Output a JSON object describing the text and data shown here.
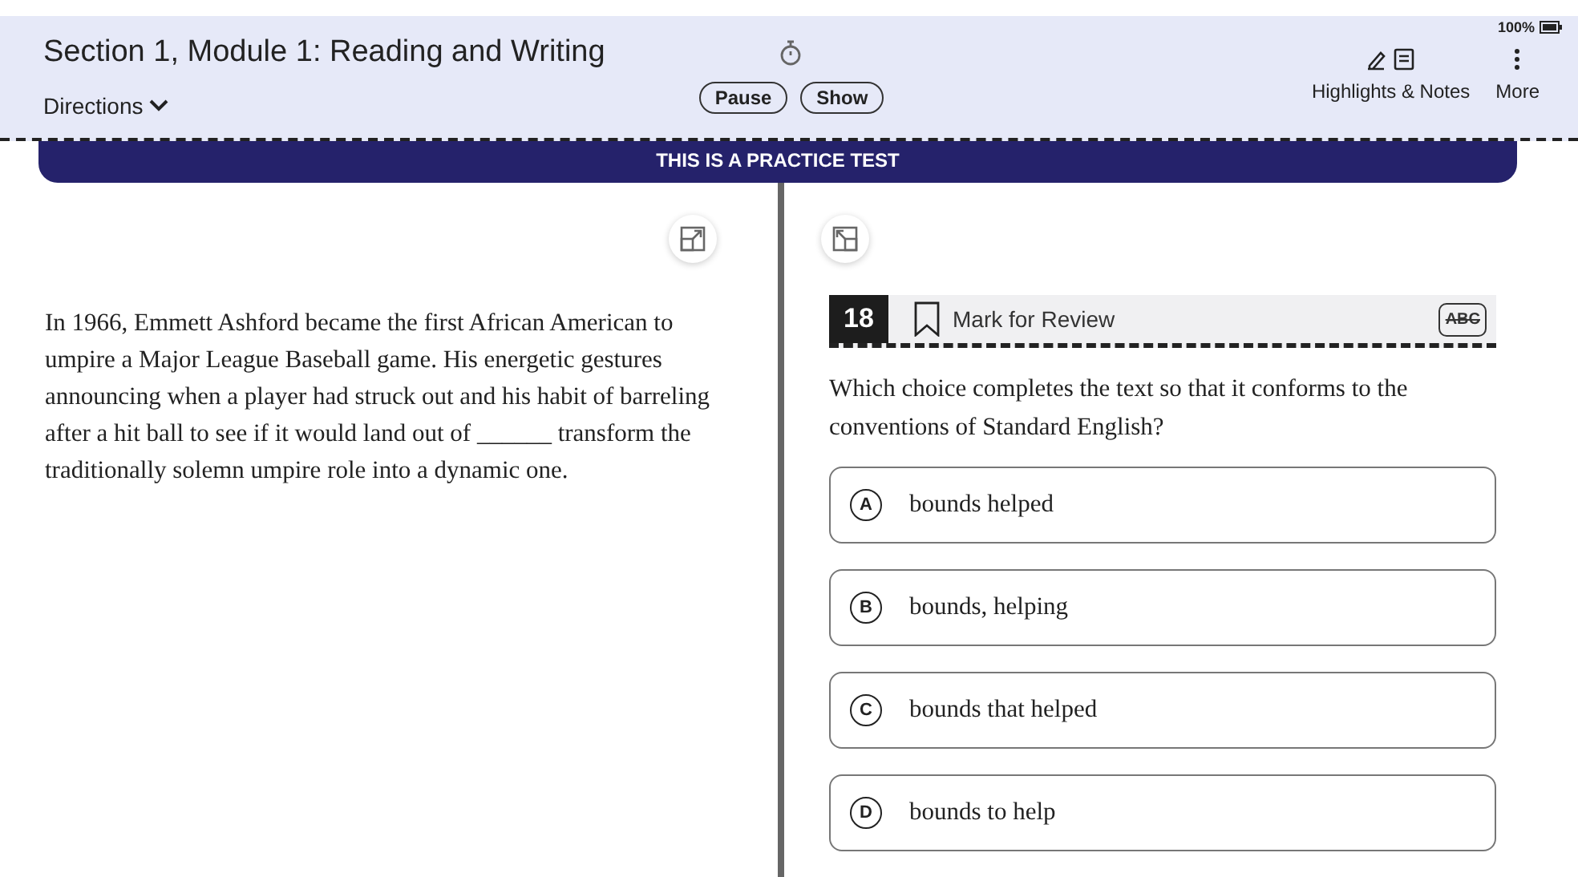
{
  "header": {
    "title": "Section 1, Module 1: Reading and Writing",
    "directions": "Directions",
    "timer_buttons": [
      "Pause",
      "Show"
    ],
    "battery": "100%",
    "tools": [
      {
        "label": "Highlights & Notes",
        "kind": "highlights"
      },
      {
        "label": "More",
        "kind": "more"
      }
    ]
  },
  "banner": "THIS IS A PRACTICE TEST",
  "passage": "In 1966, Emmett Ashford became the first African American to umpire a Major League Baseball game. His energetic gestures announcing when a player had struck out and his habit of barreling after a hit ball to see if it would land out of ______ transform the traditionally solemn umpire role into a dynamic one.",
  "question": {
    "number": "18",
    "mark_for_review": "Mark for Review",
    "marked": false,
    "eliminator": "ABC",
    "prompt": "Which choice completes the text so that it conforms to the conventions of Standard English?",
    "choices": [
      {
        "letter": "A",
        "text": "bounds helped",
        "selected": false
      },
      {
        "letter": "B",
        "text": "bounds, helping",
        "selected": false
      },
      {
        "letter": "C",
        "text": "bounds that helped",
        "selected": false
      },
      {
        "letter": "D",
        "text": "bounds to help",
        "selected": false
      }
    ]
  }
}
